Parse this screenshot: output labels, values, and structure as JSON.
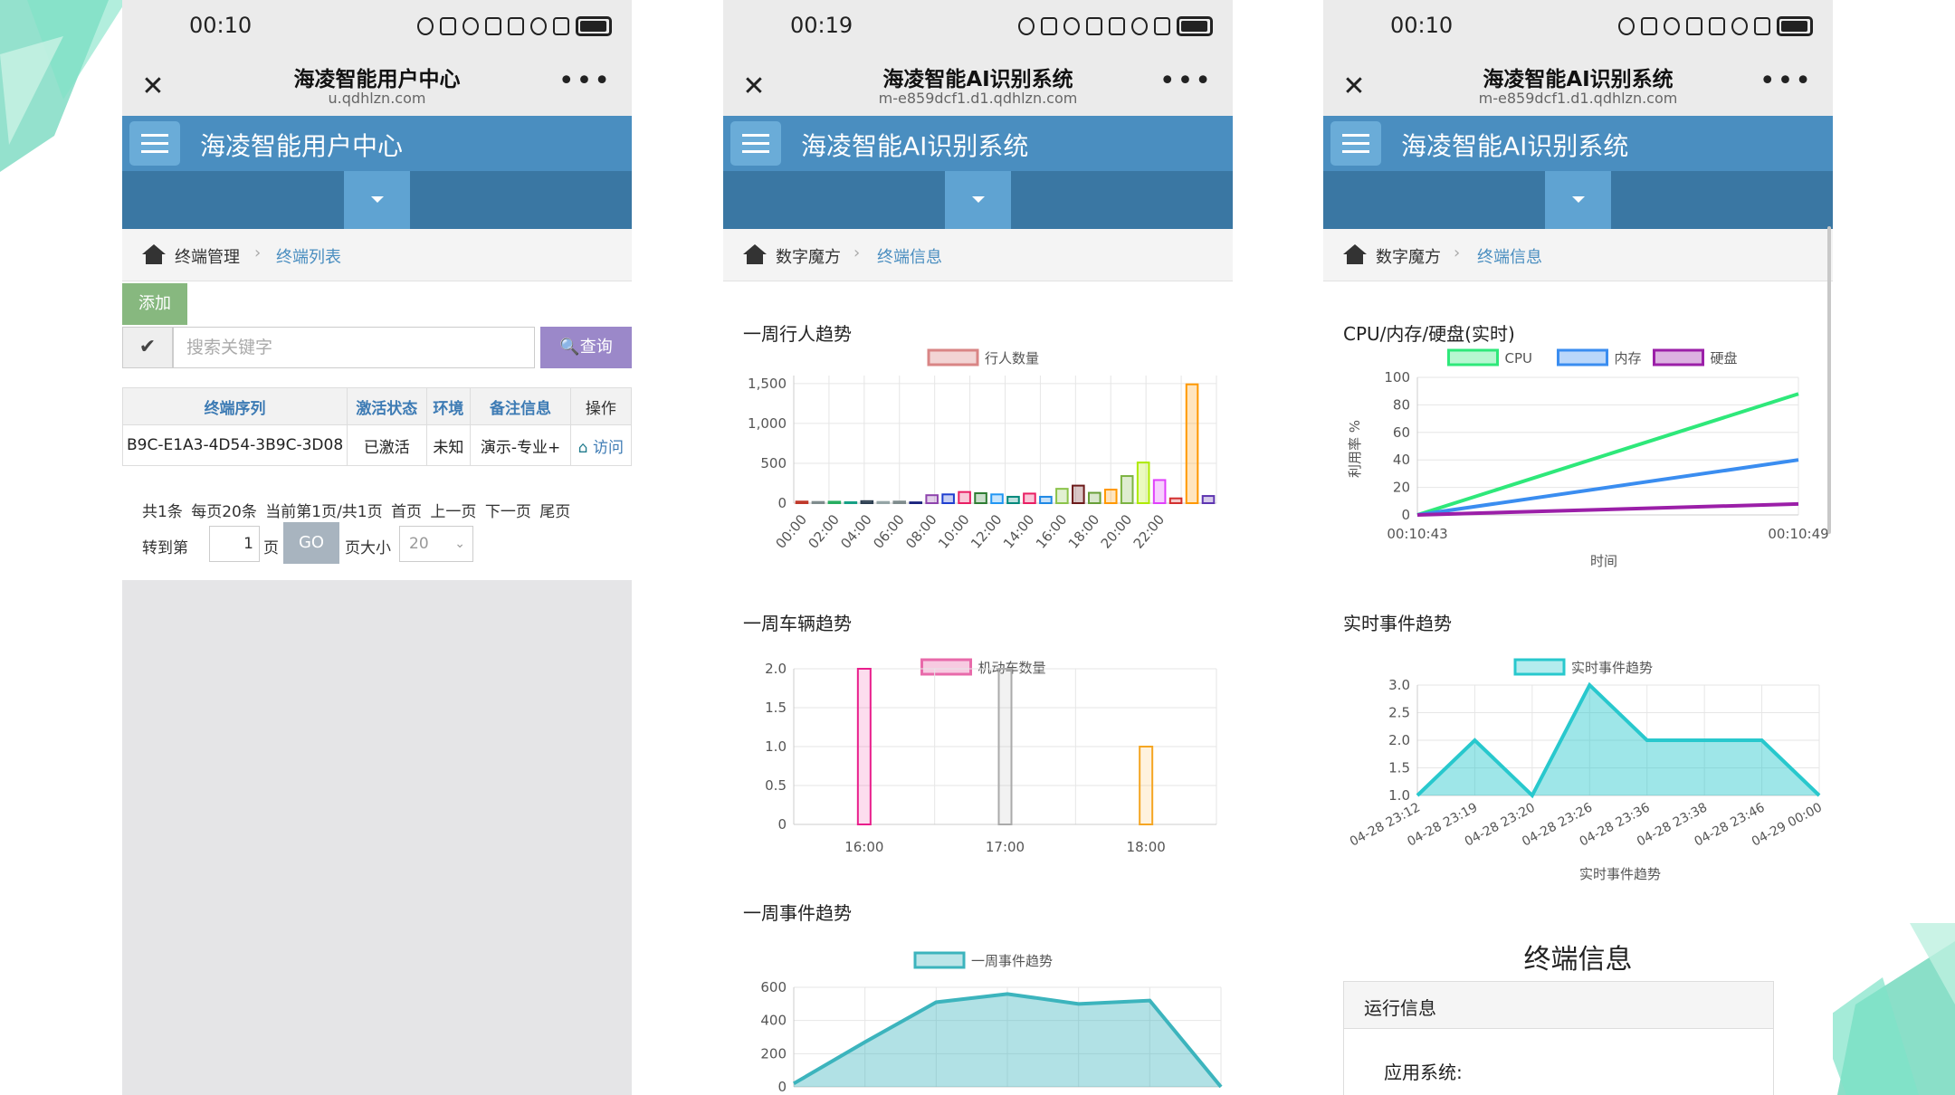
{
  "phone1": {
    "status": {
      "time": "00:10"
    },
    "nav": {
      "close": "✕",
      "title": "海凌智能用户中心",
      "url": "u.qdhlzn.com",
      "more": "•••"
    },
    "app": {
      "title": "海凌智能用户中心"
    },
    "breadcrumb": {
      "root": "终端管理",
      "sep": "›",
      "current": "终端列表"
    },
    "add_label": "添加",
    "search": {
      "check": "✔",
      "placeholder": "搜索关键字",
      "button": "🔍查询"
    },
    "table": {
      "headers": [
        "终端序列",
        "激活状态",
        "环境",
        "备注信息",
        "操作"
      ],
      "rows": [
        [
          "B9C-E1A3-4D54-3B9C-3D08",
          "已激活",
          "未知",
          "演示-专业+",
          "访问"
        ]
      ],
      "visit_icon": "home-icon"
    },
    "pager": {
      "summary": "共1条 每页20条 当前第1页/共1页 首页 上一页 下一页 尾页",
      "goto_prefix": "转到第",
      "page_value": "1",
      "goto_suffix": "页",
      "go": "GO",
      "size_label": "页大小",
      "size_value": "20"
    }
  },
  "phone2": {
    "status": {
      "time": "00:19"
    },
    "nav": {
      "close": "✕",
      "title": "海凌智能AI识别系统",
      "url": "m-e859dcf1.d1.qdhlzn.com",
      "more": "•••"
    },
    "app": {
      "title": "海凌智能AI识别系统"
    },
    "breadcrumb": {
      "root": "数字魔方",
      "sep": "›",
      "current": "终端信息"
    }
  },
  "phone3": {
    "status": {
      "time": "00:10"
    },
    "nav": {
      "close": "✕",
      "title": "海凌智能AI识别系统",
      "url": "m-e859dcf1.d1.qdhlzn.com",
      "more": "•••"
    },
    "app": {
      "title": "海凌智能AI识别系统"
    },
    "breadcrumb": {
      "root": "数字魔方",
      "sep": "›",
      "current": "终端信息"
    },
    "terminal_title": "终端信息",
    "panel_title": "运行信息",
    "panel_line": "应用系统:"
  },
  "chart_data": [
    {
      "type": "bar",
      "title": "一周行人趋势",
      "legend": "行人数量",
      "x_tick_labels": [
        "00:00",
        "02:00",
        "04:00",
        "06:00",
        "08:00",
        "10:00",
        "12:00",
        "14:00",
        "16:00",
        "18:00",
        "20:00",
        "22:00"
      ],
      "values": [
        20,
        15,
        18,
        12,
        25,
        15,
        20,
        10,
        100,
        110,
        140,
        125,
        110,
        80,
        120,
        80,
        180,
        220,
        130,
        170,
        340,
        510,
        290,
        60,
        1490,
        90
      ],
      "colors": [
        "#c0392b",
        "#7f8c8d",
        "#27ae60",
        "#16a085",
        "#2c3e50",
        "#95a5a6",
        "#7f8c8d",
        "#1a237e",
        "#8e44ad",
        "#1f3fd0",
        "#e91e63",
        "#2e7d32",
        "#2196f3",
        "#00897b",
        "#e91e63",
        "#1e88e5",
        "#8bc34a",
        "#6d1b1b",
        "#689f38",
        "#ff9800",
        "#7cb342",
        "#aeea00",
        "#e040fb",
        "#d32f2f",
        "#ff9800",
        "#5e35b1"
      ],
      "ylim": [
        0,
        1600
      ],
      "y_ticks": [
        "0",
        "500",
        "1,000",
        "1,500"
      ]
    },
    {
      "type": "bar",
      "title": "一周车辆趋势",
      "legend": "机动车数量",
      "categories": [
        "16:00",
        "17:00",
        "18:00"
      ],
      "values": [
        2,
        2,
        1
      ],
      "colors": [
        "#e91e8c",
        "#aaaaaa",
        "#f5a623"
      ],
      "ylim": [
        0,
        2
      ],
      "y_ticks": [
        "0",
        "0.5",
        "1.0",
        "1.5",
        "2.0"
      ]
    },
    {
      "type": "area",
      "title": "一周事件趋势",
      "legend": "一周事件趋势",
      "values": [
        20,
        270,
        510,
        560,
        500,
        520,
        0
      ],
      "ylim": [
        0,
        600
      ],
      "y_ticks": [
        "0",
        "200",
        "400",
        "600"
      ],
      "color": "#3cb4bd"
    },
    {
      "type": "line",
      "title": "CPU/内存/硬盘(实时)",
      "series": [
        {
          "name": "CPU",
          "color": "#2ee87a",
          "values": [
            0,
            88
          ]
        },
        {
          "name": "内存",
          "color": "#3a8df0",
          "values": [
            0,
            40
          ]
        },
        {
          "name": "硬盘",
          "color": "#9b1fa8",
          "values": [
            0,
            8
          ]
        }
      ],
      "x": [
        "00:10:43",
        "00:10:49"
      ],
      "ylabel": "利用率 %",
      "xlabel": "时间",
      "ylim": [
        0,
        100
      ],
      "y_ticks": [
        "0",
        "20",
        "40",
        "60",
        "80",
        "100"
      ]
    },
    {
      "type": "area",
      "title": "实时事件趋势",
      "legend": "实时事件趋势",
      "categories": [
        "04-28 23:12",
        "04-28 23:19",
        "04-28 23:20",
        "04-28 23:26",
        "04-28 23:36",
        "04-28 23:38",
        "04-28 23:46",
        "04-29 00:00"
      ],
      "values": [
        1,
        2,
        1,
        3,
        2,
        2,
        2,
        1
      ],
      "xlabel": "实时事件趋势",
      "ylim": [
        1,
        3
      ],
      "y_ticks": [
        "1.0",
        "1.5",
        "2.0",
        "2.5",
        "3.0"
      ],
      "color": "#28c8cd"
    }
  ]
}
